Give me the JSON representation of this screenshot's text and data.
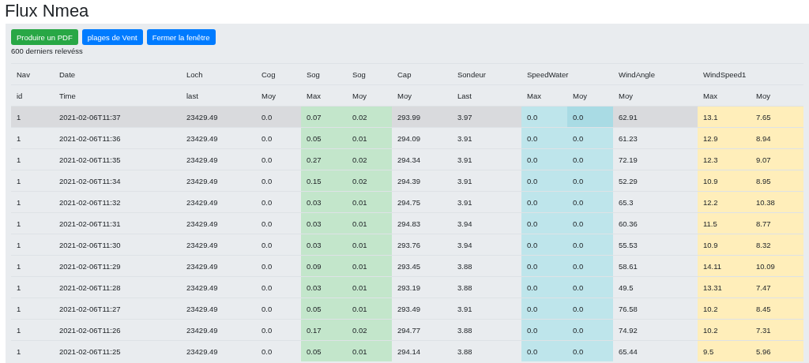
{
  "title": "Flux Nmea",
  "buttons": [
    {
      "label": "Produire un PDF",
      "kind": "success"
    },
    {
      "label": "plages de Vent",
      "kind": "primary"
    },
    {
      "label": "Fermer la fenêtre",
      "kind": "primary"
    }
  ],
  "subtitle": "600 derniers relevéss",
  "table": {
    "columns": [
      {
        "top": "Nav",
        "sub": "id"
      },
      {
        "top": "Date",
        "sub": "Time"
      },
      {
        "top": "Loch",
        "sub": "last"
      },
      {
        "top": "Cog",
        "sub": "Moy"
      },
      {
        "top": "Sog",
        "sub": "Max",
        "color": "#c3e6cb"
      },
      {
        "top": "Sog",
        "sub": "Moy",
        "color": "#c3e6cb"
      },
      {
        "top": "Cap",
        "sub": "Moy"
      },
      {
        "top": "Sondeur",
        "sub": "Last"
      },
      {
        "top": "SpeedWater",
        "sub": "Max",
        "color": "#bee5eb"
      },
      {
        "sub": "Moy",
        "color": "#bee5eb"
      },
      {
        "top": "WindAngle",
        "sub": "Moy"
      },
      {
        "top": "WindSpeed1",
        "sub": "Max",
        "color": "#ffeeba"
      },
      {
        "sub": "Moy",
        "color": "#ffeeba"
      }
    ],
    "rows": [
      {
        "selected": true,
        "cells": [
          "1",
          "2021-02-06T11:37",
          "23429.49",
          "0.0",
          "0.07",
          "0.02",
          "293.99",
          "3.97",
          "0.0",
          "0.0",
          "62.91",
          "13.1",
          "7.65"
        ]
      },
      {
        "selected": false,
        "cells": [
          "1",
          "2021-02-06T11:36",
          "23429.49",
          "0.0",
          "0.05",
          "0.01",
          "294.09",
          "3.91",
          "0.0",
          "0.0",
          "61.23",
          "12.9",
          "8.94"
        ]
      },
      {
        "selected": false,
        "cells": [
          "1",
          "2021-02-06T11:35",
          "23429.49",
          "0.0",
          "0.27",
          "0.02",
          "294.34",
          "3.91",
          "0.0",
          "0.0",
          "72.19",
          "12.3",
          "9.07"
        ]
      },
      {
        "selected": false,
        "cells": [
          "1",
          "2021-02-06T11:34",
          "23429.49",
          "0.0",
          "0.15",
          "0.02",
          "294.39",
          "3.91",
          "0.0",
          "0.0",
          "52.29",
          "10.9",
          "8.95"
        ]
      },
      {
        "selected": false,
        "cells": [
          "1",
          "2021-02-06T11:32",
          "23429.49",
          "0.0",
          "0.03",
          "0.01",
          "294.75",
          "3.91",
          "0.0",
          "0.0",
          "65.3",
          "12.2",
          "10.38"
        ]
      },
      {
        "selected": false,
        "cells": [
          "1",
          "2021-02-06T11:31",
          "23429.49",
          "0.0",
          "0.03",
          "0.01",
          "294.83",
          "3.94",
          "0.0",
          "0.0",
          "60.36",
          "11.5",
          "8.77"
        ]
      },
      {
        "selected": false,
        "cells": [
          "1",
          "2021-02-06T11:30",
          "23429.49",
          "0.0",
          "0.03",
          "0.01",
          "293.76",
          "3.94",
          "0.0",
          "0.0",
          "55.53",
          "10.9",
          "8.32"
        ]
      },
      {
        "selected": false,
        "cells": [
          "1",
          "2021-02-06T11:29",
          "23429.49",
          "0.0",
          "0.09",
          "0.01",
          "293.45",
          "3.88",
          "0.0",
          "0.0",
          "58.61",
          "14.11",
          "10.09"
        ]
      },
      {
        "selected": false,
        "cells": [
          "1",
          "2021-02-06T11:28",
          "23429.49",
          "0.0",
          "0.03",
          "0.01",
          "293.19",
          "3.88",
          "0.0",
          "0.0",
          "49.5",
          "13.31",
          "7.47"
        ]
      },
      {
        "selected": false,
        "cells": [
          "1",
          "2021-02-06T11:27",
          "23429.49",
          "0.0",
          "0.05",
          "0.01",
          "293.49",
          "3.91",
          "0.0",
          "0.0",
          "76.58",
          "10.2",
          "8.45"
        ]
      },
      {
        "selected": false,
        "cells": [
          "1",
          "2021-02-06T11:26",
          "23429.49",
          "0.0",
          "0.17",
          "0.02",
          "294.77",
          "3.88",
          "0.0",
          "0.0",
          "74.92",
          "10.2",
          "7.31"
        ]
      },
      {
        "selected": false,
        "cells": [
          "1",
          "2021-02-06T11:25",
          "23429.49",
          "0.0",
          "0.05",
          "0.01",
          "294.14",
          "3.88",
          "0.0",
          "0.0",
          "65.44",
          "9.5",
          "5.96"
        ]
      }
    ]
  }
}
